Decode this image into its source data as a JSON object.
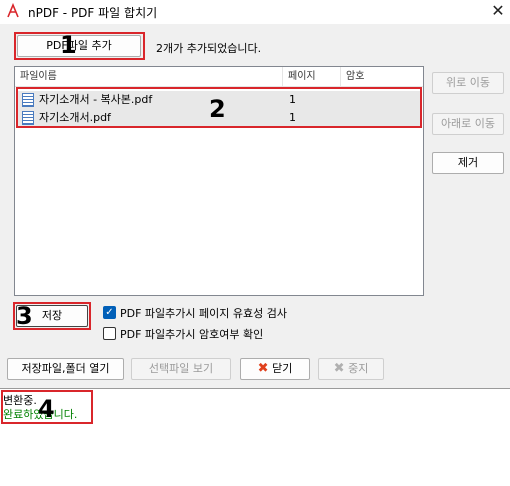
{
  "window": {
    "title": "nPDF - PDF 파일 합치기",
    "close_glyph": "✕"
  },
  "toolbar": {
    "add_pdf_label": "PDF파일 추가",
    "status": "2개가 추가되었습니다."
  },
  "list": {
    "columns": [
      "파일이름",
      "페이지",
      "암호"
    ],
    "rows": [
      {
        "name": "자기소개서 - 복사본.pdf",
        "pages": "1",
        "password": ""
      },
      {
        "name": "자기소개서.pdf",
        "pages": "1",
        "password": ""
      }
    ]
  },
  "side_buttons": {
    "up": "위로 이동",
    "down": "아래로 이동",
    "remove": "제거"
  },
  "save_label": "저장",
  "options": {
    "validate": {
      "label": "PDF 파일추가시 페이지 유효성 검사",
      "checked": true
    },
    "password_check": {
      "label": "PDF 파일추가시 암호여부 확인",
      "checked": false
    }
  },
  "bottom_buttons": {
    "open_folder": "저장파일,폴더 열기",
    "view_selected": "선택파일 보기",
    "close": "닫기",
    "stop": "중지"
  },
  "log": {
    "line1": "변환중.",
    "line2": "완료하였습니다."
  },
  "annotations": {
    "n1": "1",
    "n2": "2",
    "n3": "3",
    "n4": "4"
  },
  "colors": {
    "annotation_box": "#d9262b",
    "close_icon": "#e0401c",
    "log_success": "#008000",
    "checkbox_on": "#005fb8"
  }
}
